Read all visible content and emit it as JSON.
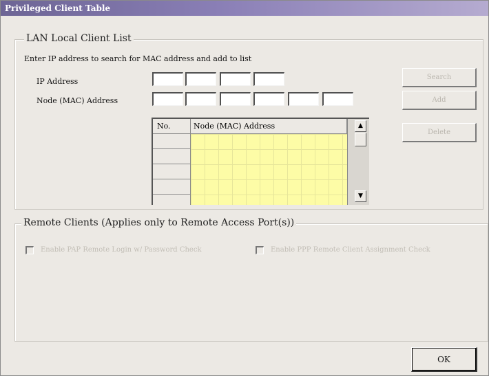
{
  "window": {
    "title": "Privileged Client Table"
  },
  "lan": {
    "group_title": "LAN Local Client List",
    "instructions": "Enter IP address to search for MAC address and add to list",
    "ip_label": "IP Address",
    "mac_label": "Node (MAC) Address",
    "ip_octets": [
      "",
      "",
      "",
      ""
    ],
    "mac_parts": [
      "",
      "",
      "",
      "",
      "",
      ""
    ],
    "buttons": {
      "search": "Search",
      "add": "Add",
      "delete": "Delete"
    },
    "table": {
      "columns": [
        "No.",
        "Node (MAC) Address"
      ],
      "rows": []
    }
  },
  "remote": {
    "group_title": "Remote Clients (Applies only to Remote Access Port(s))",
    "options": [
      {
        "label": "Enable PAP Remote Login w/ Password Check",
        "checked": false,
        "enabled": false
      },
      {
        "label": "Enable PPP Remote Client Assignment Check",
        "checked": false,
        "enabled": false
      }
    ]
  },
  "footer": {
    "ok_label": "OK"
  },
  "colors": {
    "titlebar": "#6d6595",
    "list_bg": "#fdfca6",
    "dialog_bg": "#ece9e4"
  }
}
